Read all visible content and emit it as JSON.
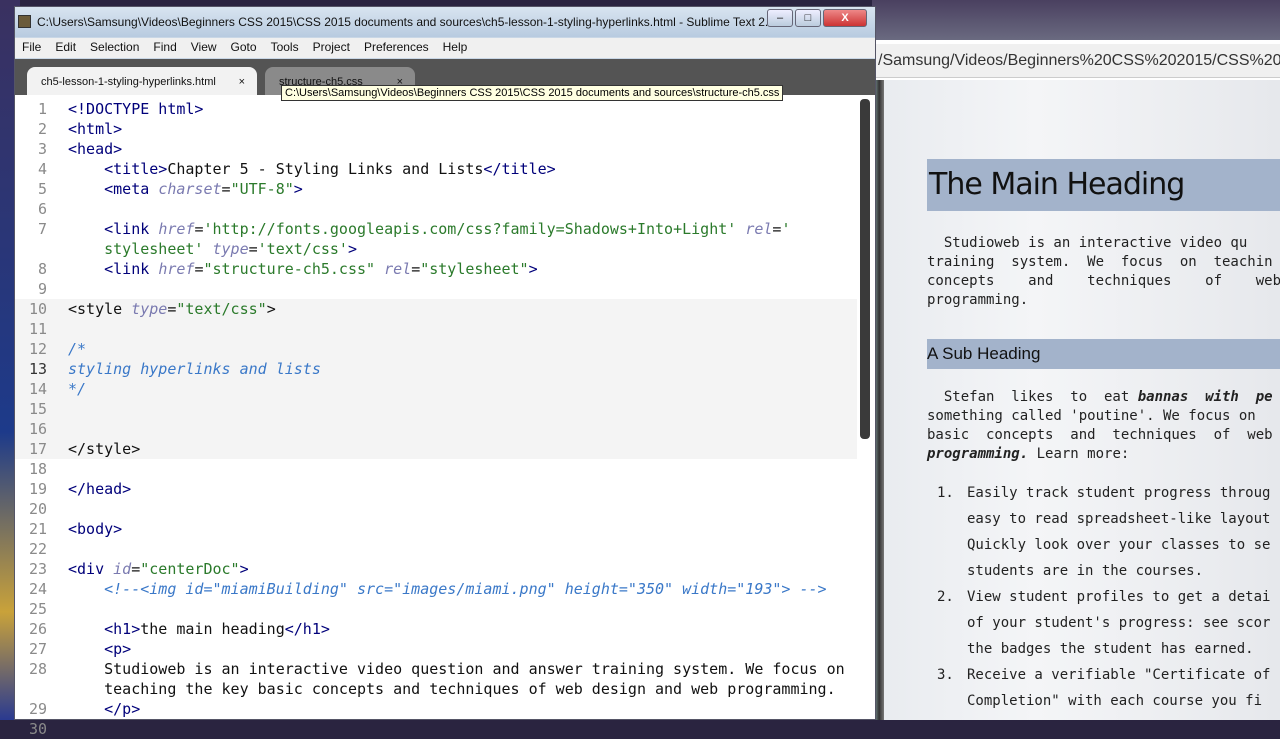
{
  "window": {
    "title": "C:\\Users\\Samsung\\Videos\\Beginners CSS 2015\\CSS 2015 documents and sources\\ch5-lesson-1-styling-hyperlinks.html - Sublime Text 2...",
    "minimize": "–",
    "maximize": "□",
    "close": "X"
  },
  "menu": [
    "File",
    "Edit",
    "Selection",
    "Find",
    "View",
    "Goto",
    "Tools",
    "Project",
    "Preferences",
    "Help"
  ],
  "tabs": [
    {
      "label": "ch5-lesson-1-styling-hyperlinks.html",
      "close": "×"
    },
    {
      "label": "structure-ch5.css",
      "close": "×"
    }
  ],
  "tooltip": "C:\\Users\\Samsung\\Videos\\Beginners CSS 2015\\CSS 2015 documents and sources\\structure-ch5.css",
  "code": [
    {
      "n": "1",
      "t": [
        [
          "t",
          "<!DOCTYPE html>"
        ]
      ]
    },
    {
      "n": "2",
      "t": [
        [
          "t",
          "<html>"
        ]
      ]
    },
    {
      "n": "3",
      "t": [
        [
          "t",
          "<head>"
        ]
      ]
    },
    {
      "n": "4",
      "t": [
        [
          "p",
          "    "
        ],
        [
          "t",
          "<title>"
        ],
        [
          "p",
          "Chapter 5 - Styling Links and Lists"
        ],
        [
          "t",
          "</title>"
        ]
      ]
    },
    {
      "n": "5",
      "t": [
        [
          "p",
          "    "
        ],
        [
          "t",
          "<meta "
        ],
        [
          "a",
          "charset"
        ],
        [
          "p",
          "="
        ],
        [
          "s",
          "\"UTF-8\""
        ],
        [
          "t",
          ">"
        ]
      ]
    },
    {
      "n": "6",
      "t": []
    },
    {
      "n": "7",
      "t": [
        [
          "p",
          "    "
        ],
        [
          "t",
          "<link "
        ],
        [
          "a",
          "href"
        ],
        [
          "p",
          "="
        ],
        [
          "s",
          "'http://fonts.googleapis.com/css?family=Shadows+Into+Light'"
        ],
        [
          "p",
          " "
        ],
        [
          "a",
          "rel"
        ],
        [
          "p",
          "="
        ],
        [
          "s",
          "'"
        ]
      ]
    },
    {
      "n": "",
      "t": [
        [
          "p",
          "    "
        ],
        [
          "s",
          "stylesheet'"
        ],
        [
          "p",
          " "
        ],
        [
          "a",
          "type"
        ],
        [
          "p",
          "="
        ],
        [
          "s",
          "'text/css'"
        ],
        [
          "t",
          ">"
        ]
      ]
    },
    {
      "n": "8",
      "t": [
        [
          "p",
          "    "
        ],
        [
          "t",
          "<link "
        ],
        [
          "a",
          "href"
        ],
        [
          "p",
          "="
        ],
        [
          "s",
          "\"structure-ch5.css\""
        ],
        [
          "p",
          " "
        ],
        [
          "a",
          "rel"
        ],
        [
          "p",
          "="
        ],
        [
          "s",
          "\"stylesheet\""
        ],
        [
          "t",
          ">"
        ]
      ]
    },
    {
      "n": "9",
      "t": []
    },
    {
      "n": "10",
      "t": [
        [
          "p",
          "<style "
        ],
        [
          "a",
          "type"
        ],
        [
          "p",
          "="
        ],
        [
          "s",
          "\"text/css\""
        ],
        [
          "p",
          ">"
        ]
      ],
      "shade": true
    },
    {
      "n": "11",
      "t": [],
      "shade": true
    },
    {
      "n": "12",
      "t": [
        [
          "c",
          "/*"
        ]
      ],
      "shade": true
    },
    {
      "n": "13",
      "t": [
        [
          "c",
          "styling hyperlinks and lists"
        ]
      ],
      "shade": true,
      "cur": true
    },
    {
      "n": "14",
      "t": [
        [
          "c",
          "*/"
        ]
      ],
      "shade": true
    },
    {
      "n": "15",
      "t": [],
      "shade": true
    },
    {
      "n": "16",
      "t": [],
      "shade": true
    },
    {
      "n": "17",
      "t": [
        [
          "p",
          "</style>"
        ]
      ],
      "shade": true
    },
    {
      "n": "18",
      "t": []
    },
    {
      "n": "19",
      "t": [
        [
          "t",
          "</head>"
        ]
      ]
    },
    {
      "n": "20",
      "t": []
    },
    {
      "n": "21",
      "t": [
        [
          "t",
          "<body>"
        ]
      ]
    },
    {
      "n": "22",
      "t": []
    },
    {
      "n": "23",
      "t": [
        [
          "t",
          "<div "
        ],
        [
          "a",
          "id"
        ],
        [
          "p",
          "="
        ],
        [
          "s",
          "\"centerDoc\""
        ],
        [
          "t",
          ">"
        ]
      ]
    },
    {
      "n": "24",
      "t": [
        [
          "p",
          "    "
        ],
        [
          "c",
          "<!--<img id=\"miamiBuilding\" src=\"images/miami.png\" height=\"350\" width=\"193\"> -->"
        ]
      ]
    },
    {
      "n": "25",
      "t": []
    },
    {
      "n": "26",
      "t": [
        [
          "p",
          "    "
        ],
        [
          "t",
          "<h1>"
        ],
        [
          "p",
          "the main heading"
        ],
        [
          "t",
          "</h1>"
        ]
      ]
    },
    {
      "n": "27",
      "t": [
        [
          "p",
          "    "
        ],
        [
          "t",
          "<p>"
        ]
      ]
    },
    {
      "n": "28",
      "t": [
        [
          "p",
          "    Studioweb is an interactive video question and answer training system. We focus on"
        ]
      ]
    },
    {
      "n": "",
      "t": [
        [
          "p",
          "    teaching the key basic concepts and techniques of web design and web programming."
        ]
      ]
    },
    {
      "n": "29",
      "t": [
        [
          "p",
          "    "
        ],
        [
          "t",
          "</p>"
        ]
      ]
    },
    {
      "n": "30",
      "t": []
    }
  ],
  "browser": {
    "address": "/Samsung/Videos/Beginners%20CSS%202015/CSS%202015",
    "h1": "The Main Heading",
    "p1": "  Studioweb is an interactive video qu\ntraining  system.  We  focus  on  teachin\nconcepts    and    techniques    of    web\nprogramming.",
    "h2": "A Sub Heading",
    "p2a": "  Stefan  likes  to  eat ",
    "p2b": "bannas  with  pe",
    "p2c": "\nsomething called 'poutine'. We focus on\nbasic  concepts  and  techniques  of  web\n",
    "p2d": "programming.",
    "p2e": " Learn more:",
    "list": [
      {
        "num": "1.",
        "text": "Easily track student progress throug\n    easy to read spreadsheet-like layout\n    Quickly look over your classes to se\n    students are in the courses."
      },
      {
        "num": "2.",
        "text": "View student profiles to get a detai\n    of your student's progress: see scor\n    the badges the student has earned."
      },
      {
        "num": "3.",
        "text": "Receive a verifiable \"Certificate of\n    Completion\" with each course you fi"
      }
    ]
  }
}
